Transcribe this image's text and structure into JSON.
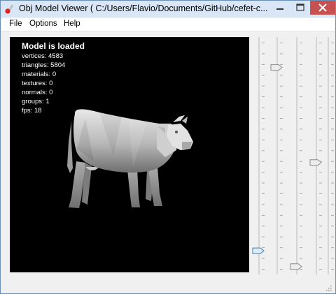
{
  "window": {
    "title": "Obj Model Viewer ( C:/Users/Flavio/Documents/GitHub/cefet-c..."
  },
  "menu": {
    "items": [
      "File",
      "Options",
      "Help"
    ]
  },
  "viewport": {
    "heading": "Model is loaded",
    "stats": [
      "vertices: 4583",
      "triangles: 5804",
      "materials: 0",
      "textures: 0",
      "normals: 0",
      "groups: 1",
      "fps: 18"
    ]
  },
  "sliders": [
    {
      "position": 0.92,
      "active": true
    },
    {
      "position": 0.11,
      "active": false
    },
    {
      "position": 0.99,
      "active": false
    },
    {
      "position": 0.53,
      "active": false
    },
    {
      "position": null,
      "active": false
    }
  ],
  "colors": {
    "title_bg": "#d9e6f5",
    "close_button": "#c75050",
    "viewport_bg": "#000000",
    "slider_active": "#3c7fb1"
  }
}
